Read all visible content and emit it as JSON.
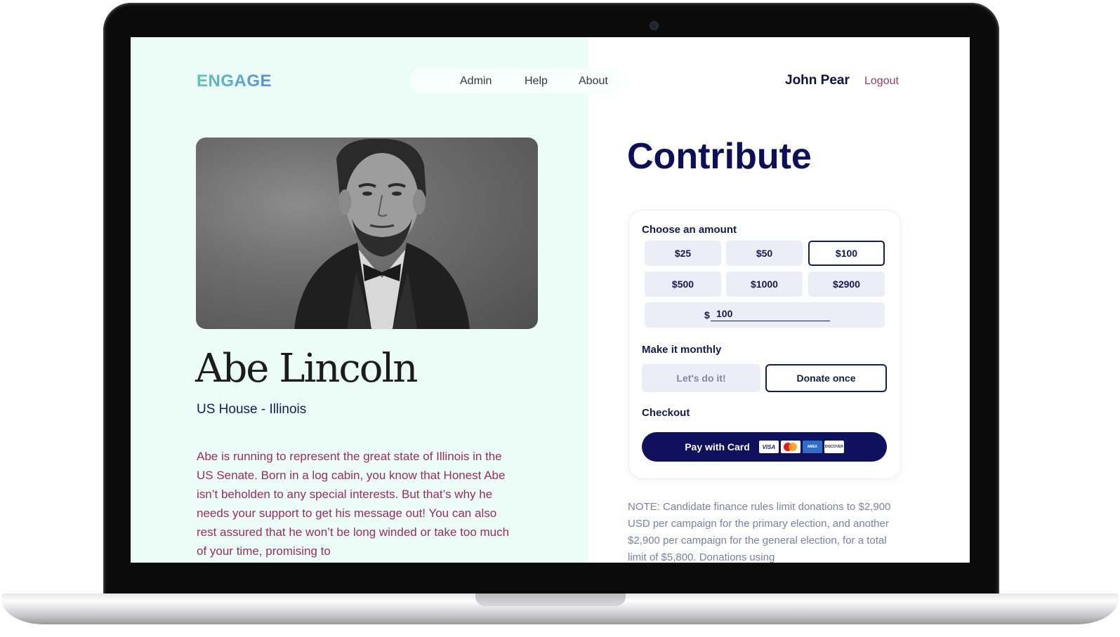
{
  "header": {
    "logo": "ENGAGE",
    "nav": [
      "Admin",
      "Help",
      "About"
    ],
    "user_name": "John Pear",
    "logout": "Logout"
  },
  "candidate": {
    "name": "Abe Lincoln",
    "office": "US House - Illinois",
    "bio": "Abe is running to represent the great state of Illinois in the US Senate. Born in a log cabin, you know that Honest Abe isn’t beholden to any special interests. But that’s why he needs your support to get his message out! You can also rest assured that he won’t be long winded or take too much of your time, promising to"
  },
  "contribute": {
    "title": "Contribute",
    "choose_label": "Choose an amount",
    "amounts": [
      "$25",
      "$50",
      "$100",
      "$500",
      "$1000",
      "$2900"
    ],
    "selected_amount": "$100",
    "currency_symbol": "$",
    "custom_amount_value": "100",
    "monthly_label": "Make it monthly",
    "monthly_yes": "Let's do it!",
    "monthly_no": "Donate once",
    "checkout_label": "Checkout",
    "pay_button": "Pay with Card",
    "card_brands": [
      "visa",
      "mastercard",
      "amex",
      "discover"
    ]
  },
  "note": "NOTE: Candidate finance rules limit donations to $2,900 USD per campaign for the primary election, and another $2,900 per campaign for the general election, for a total limit of $5,800. Donations using",
  "colors": {
    "navy": "#10115e",
    "accent_pink": "#9b3b6b",
    "left_bg": "#ecfcf6",
    "logo_gradient": [
      "#5cc8b2",
      "#5a8fd8"
    ]
  }
}
